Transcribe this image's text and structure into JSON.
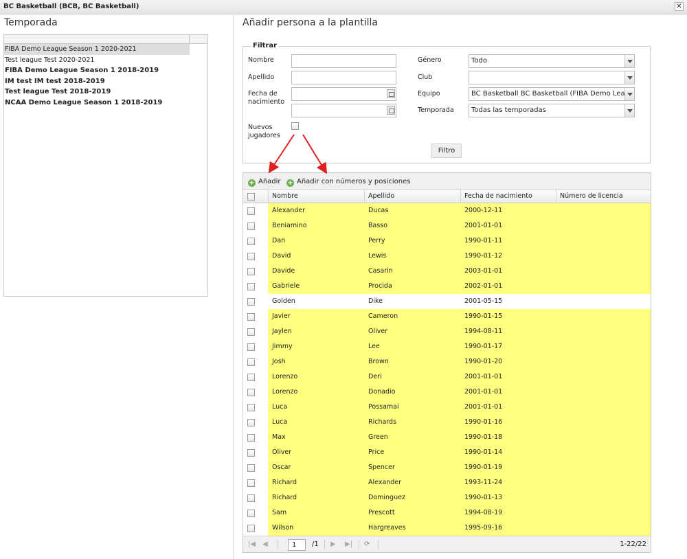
{
  "window": {
    "title": "BC Basketball (BCB, BC Basketball)",
    "close_icon": "close-icon"
  },
  "left": {
    "title": "Temporada",
    "seasons": [
      {
        "label": "FIBA Demo League Season 1 2020-2021",
        "bold": false,
        "selected": true
      },
      {
        "label": "Test league Test 2020-2021",
        "bold": false,
        "selected": false
      },
      {
        "label": "FIBA Demo League Season 1 2018-2019",
        "bold": true,
        "selected": false
      },
      {
        "label": "IM test IM test 2018-2019",
        "bold": true,
        "selected": false
      },
      {
        "label": "Test league Test 2018-2019",
        "bold": true,
        "selected": false
      },
      {
        "label": "NCAA Demo League Season 1 2018-2019",
        "bold": true,
        "selected": false
      }
    ]
  },
  "right": {
    "title": "Añadir persona a la plantilla"
  },
  "filter": {
    "legend": "Filtrar",
    "labels": {
      "nombre": "Nombre",
      "apellido": "Apellido",
      "fecha": "Fecha de nacimiento",
      "nuevos": "Nuevos jugadores",
      "genero": "Género",
      "club": "Club",
      "equipo": "Equipo",
      "temporada": "Temporada"
    },
    "values": {
      "nombre": "",
      "apellido": "",
      "fecha_from": "",
      "fecha_to": "",
      "genero": "Todo",
      "club": "",
      "equipo": "BC Basketball BC Basketball (FIBA Demo League",
      "temporada": "Todas las temporadas"
    },
    "button": "Filtro"
  },
  "toolbar": {
    "add": "Añadir",
    "add_numbers": "Añadir con números y posiciones"
  },
  "table": {
    "columns": [
      "Nombre",
      "Apellido",
      "Fecha de nacimiento",
      "Número de licencia"
    ],
    "rows": [
      {
        "nombre": "Alexander",
        "apellido": "Ducas",
        "fecha": "2000-12-11",
        "licencia": "",
        "highlight": true
      },
      {
        "nombre": "Beniamino",
        "apellido": "Basso",
        "fecha": "2001-01-01",
        "licencia": "",
        "highlight": true
      },
      {
        "nombre": "Dan",
        "apellido": "Perry",
        "fecha": "1990-01-11",
        "licencia": "",
        "highlight": true
      },
      {
        "nombre": "David",
        "apellido": "Lewis",
        "fecha": "1990-01-12",
        "licencia": "",
        "highlight": true
      },
      {
        "nombre": "Davide",
        "apellido": "Casarin",
        "fecha": "2003-01-01",
        "licencia": "",
        "highlight": true
      },
      {
        "nombre": "Gabriele",
        "apellido": "Procida",
        "fecha": "2002-01-01",
        "licencia": "",
        "highlight": true
      },
      {
        "nombre": "Golden",
        "apellido": "Dike",
        "fecha": "2001-05-15",
        "licencia": "",
        "highlight": false
      },
      {
        "nombre": "Javier",
        "apellido": "Cameron",
        "fecha": "1990-01-15",
        "licencia": "",
        "highlight": true
      },
      {
        "nombre": "Jaylen",
        "apellido": "Oliver",
        "fecha": "1994-08-11",
        "licencia": "",
        "highlight": true
      },
      {
        "nombre": "Jimmy",
        "apellido": "Lee",
        "fecha": "1990-01-17",
        "licencia": "",
        "highlight": true
      },
      {
        "nombre": "Josh",
        "apellido": "Brown",
        "fecha": "1990-01-20",
        "licencia": "",
        "highlight": true
      },
      {
        "nombre": "Lorenzo",
        "apellido": "Deri",
        "fecha": "2001-01-01",
        "licencia": "",
        "highlight": true
      },
      {
        "nombre": "Lorenzo",
        "apellido": "Donadio",
        "fecha": "2001-01-01",
        "licencia": "",
        "highlight": true
      },
      {
        "nombre": "Luca",
        "apellido": "Possamai",
        "fecha": "2001-01-01",
        "licencia": "",
        "highlight": true
      },
      {
        "nombre": "Luca",
        "apellido": "Richards",
        "fecha": "1990-01-16",
        "licencia": "",
        "highlight": true
      },
      {
        "nombre": "Max",
        "apellido": "Green",
        "fecha": "1990-01-18",
        "licencia": "",
        "highlight": true
      },
      {
        "nombre": "Oliver",
        "apellido": "Price",
        "fecha": "1990-01-14",
        "licencia": "",
        "highlight": true
      },
      {
        "nombre": "Oscar",
        "apellido": "Spencer",
        "fecha": "1990-01-19",
        "licencia": "",
        "highlight": true
      },
      {
        "nombre": "Richard",
        "apellido": "Alexander",
        "fecha": "1993-11-24",
        "licencia": "",
        "highlight": true
      },
      {
        "nombre": "Richard",
        "apellido": "Dominguez",
        "fecha": "1990-01-13",
        "licencia": "",
        "highlight": true
      },
      {
        "nombre": "Sam",
        "apellido": "Prescott",
        "fecha": "1994-08-19",
        "licencia": "",
        "highlight": true
      },
      {
        "nombre": "Wilson",
        "apellido": "Hargreaves",
        "fecha": "1995-09-16",
        "licencia": "",
        "highlight": true
      }
    ]
  },
  "pager": {
    "page": "1",
    "of": "/1",
    "summary": "1-22/22"
  },
  "colors": {
    "highlight": "#ffff80",
    "arrow": "#e02020",
    "add_icon": "#6ab04c"
  }
}
